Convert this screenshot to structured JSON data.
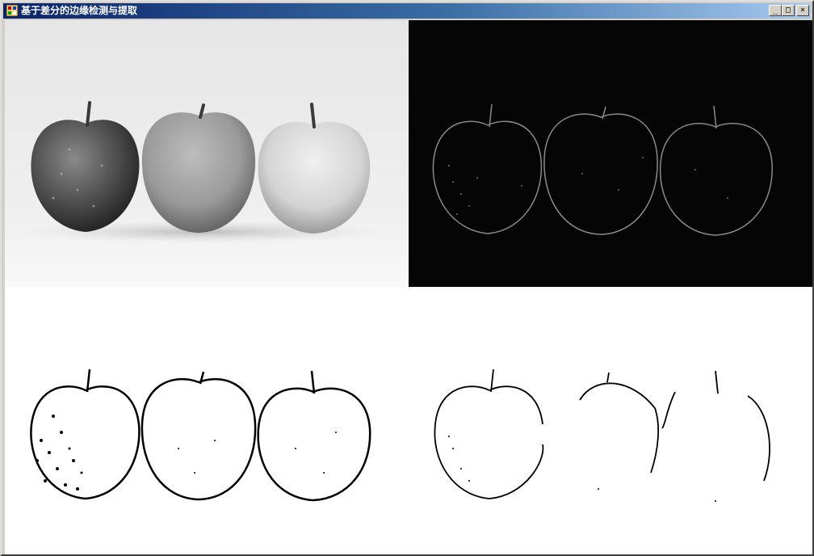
{
  "window": {
    "title": "基于差分的边缘检测与提取",
    "icon": "app-icon",
    "controls": {
      "minimize": "_",
      "maximize": "□",
      "close": "×"
    }
  },
  "panels": [
    {
      "name": "original-grayscale-image",
      "content": "grayscale photo of three apples"
    },
    {
      "name": "difference-edge-image",
      "content": "edge map on black background"
    },
    {
      "name": "binary-edge-image-dense",
      "content": "black edge outlines on white"
    },
    {
      "name": "binary-edge-image-sparse",
      "content": "sparser black edge outlines on white"
    }
  ],
  "colors": {
    "title_start": "#0a246a",
    "title_end": "#a6caf0",
    "frame": "#d4d0c8"
  }
}
